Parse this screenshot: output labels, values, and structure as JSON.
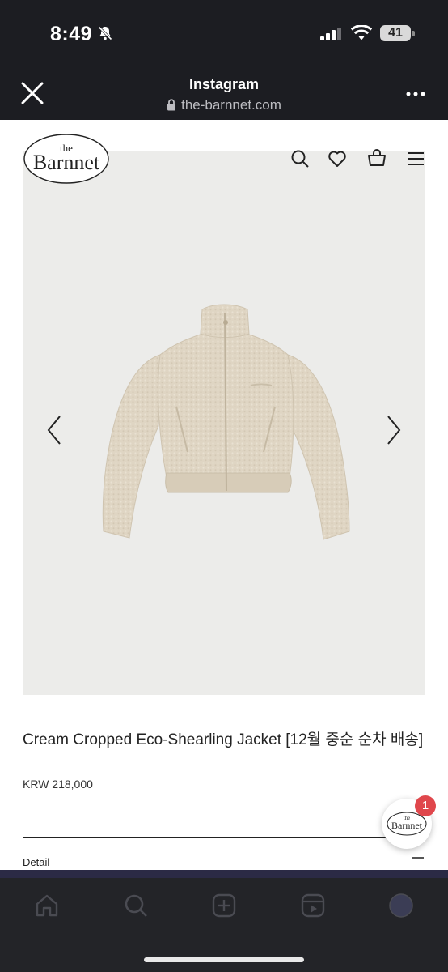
{
  "status_bar": {
    "time": "8:49",
    "battery": "41"
  },
  "browser": {
    "title": "Instagram",
    "url": "the-barnnet.com"
  },
  "site": {
    "logo_top": "the",
    "logo_main": "Barnnet",
    "nav_icons": [
      "search-icon",
      "heart-icon",
      "bag-icon",
      "menu-icon"
    ]
  },
  "product": {
    "title": "Cream Cropped Eco-Shearling Jacket [12월 중순 순차 배송]",
    "price": "KRW 218,000",
    "detail_label": "Detail"
  },
  "chat": {
    "badge_count": "1",
    "logo_top": "the",
    "logo_main": "Barnnet"
  },
  "bottom_tabs": [
    "home-icon",
    "search-icon",
    "create-icon",
    "reels-icon",
    "profile-avatar"
  ],
  "colors": {
    "page_bg": "#ffffff",
    "chrome_bg": "#1c1d22",
    "badge": "#e0474c",
    "hero_bg": "#ececea",
    "jacket": "#dfd5c3"
  }
}
